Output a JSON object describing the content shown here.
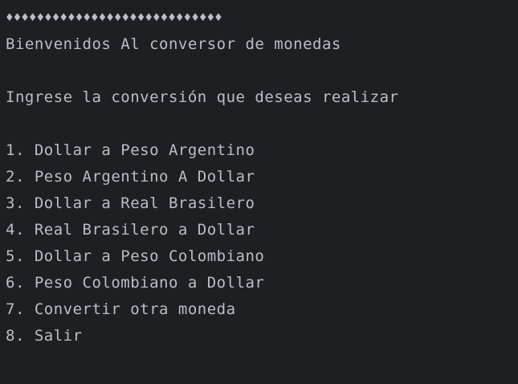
{
  "console": {
    "decoration": "♦♦♦♦♦♦♦♦♦♦♦♦♦♦♦♦♦♦♦♦♦♦♦♦♦♦♦♦",
    "welcome": "Bienvenidos Al conversor de monedas",
    "prompt": "Ingrese la conversión que deseas realizar",
    "options": [
      "1. Dollar a Peso Argentino",
      "2. Peso Argentino A Dollar",
      "3. Dollar a Real Brasilero",
      "4. Real Brasilero a Dollar",
      "5. Dollar a Peso Colombiano",
      "6. Peso Colombiano a Dollar",
      "7. Convertir otra moneda",
      "8. Salir"
    ]
  },
  "colors": {
    "background": "#1e1f22",
    "text": "#bcbec4"
  }
}
